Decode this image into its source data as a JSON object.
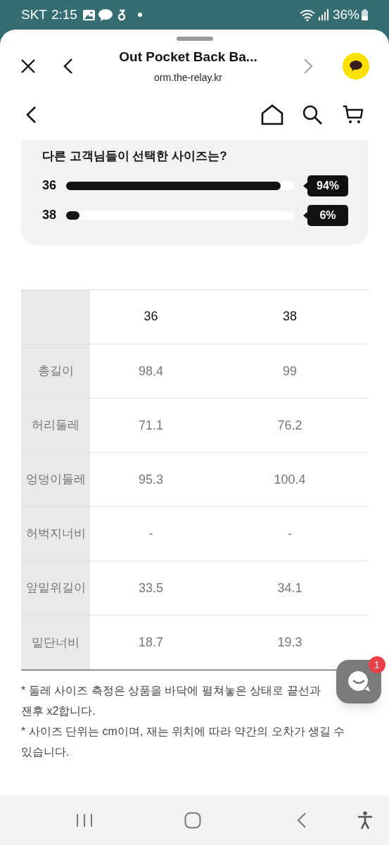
{
  "status_bar": {
    "carrier": "SKT",
    "time": "2:15",
    "battery": "36%"
  },
  "browser_header": {
    "title": "Out Pocket Back Ba...",
    "url": "orm.the-relay.kr"
  },
  "survey": {
    "question": "다른 고객님들이 선택한 사이즈는?",
    "options": [
      {
        "label": "36",
        "level": 0.94,
        "percent": "94%"
      },
      {
        "label": "38",
        "level": 0.06,
        "percent": "6%"
      }
    ]
  },
  "size_table": {
    "columns": [
      "36",
      "38"
    ],
    "rows": [
      {
        "label": "총길이",
        "values": [
          "98.4",
          "99"
        ]
      },
      {
        "label": "허리둘레",
        "values": [
          "71.1",
          "76.2"
        ]
      },
      {
        "label": "엉덩이둘레",
        "values": [
          "95.3",
          "100.4"
        ]
      },
      {
        "label": "허벅지너비",
        "values": [
          "-",
          "-"
        ]
      },
      {
        "label": "앞밑위길이",
        "values": [
          "33.5",
          "34.1"
        ]
      },
      {
        "label": "밑단너비",
        "values": [
          "18.7",
          "19.3"
        ]
      }
    ]
  },
  "notes": [
    "* 둘레 사이즈 측정은 상품을 바닥에 펼쳐놓은 상태로 끝선과",
    "잰후 x2합니다.",
    "* 사이즈 단위는 cm이며, 재는 위치에 따라 약간의 오차가 생길 수 있습니다."
  ],
  "chat_button": {
    "badge": "1"
  }
}
